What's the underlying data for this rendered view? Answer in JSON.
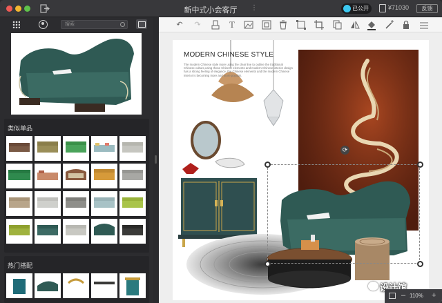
{
  "window": {
    "title": "新中式小会客厅",
    "public_label": "已公开",
    "price": "¥71030",
    "feedback_label": "反馈"
  },
  "sidebar": {
    "search_placeholder": "搜索",
    "similar_title": "类似单品",
    "hot_title": "热门搭配"
  },
  "board": {
    "title": "MODERN CHINESE STYLE",
    "body": "The modern Chinese style more using the clear line to outline the traditional Chinese culture,using those Chinese elements and modern Chinese interior design has a strong feeling of elegance, the Chinese elements and the modern Chinese interior is becoming more and more popular."
  },
  "watermark": "设计馆",
  "zoom": "110%",
  "colors": {
    "sofa_green": "#2f5a54",
    "public_indicator": "#3cc8f0",
    "accent_wall": "#6e2a16"
  }
}
